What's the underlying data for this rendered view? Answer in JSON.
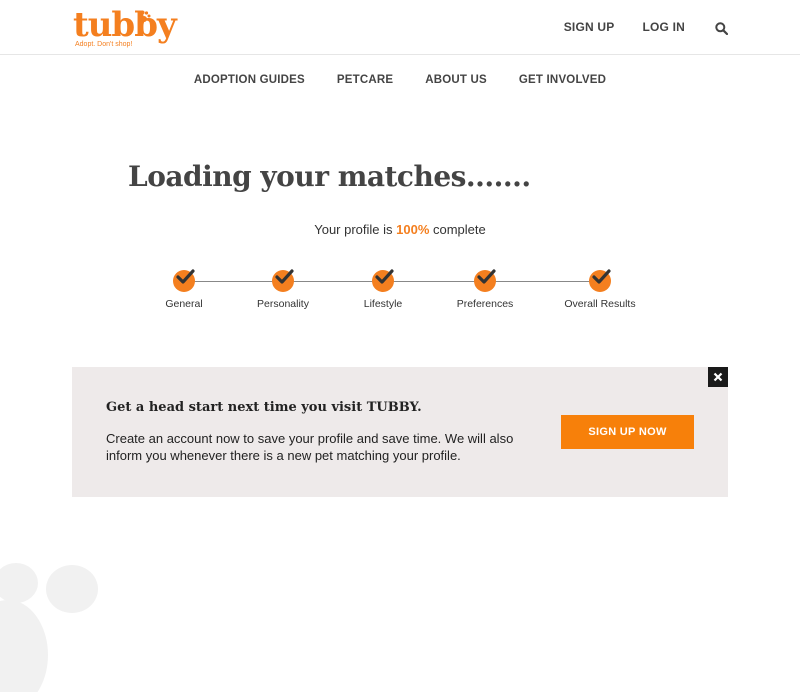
{
  "brand": {
    "name": "tubby",
    "tagline": "Adopt. Don't shop!",
    "accent_color": "#f47f1f"
  },
  "header": {
    "signup_label": "SIGN UP",
    "login_label": "LOG IN",
    "search_icon": "search-icon"
  },
  "nav": {
    "items": [
      "ADOPTION GUIDES",
      "PETCARE",
      "ABOUT US",
      "GET INVOLVED"
    ]
  },
  "main": {
    "heading": "Loading your matches.......",
    "progress_prefix": "Your profile is ",
    "progress_value": "100%",
    "progress_suffix": " complete",
    "steps": [
      {
        "label": "General",
        "completed": true
      },
      {
        "label": "Personality",
        "completed": true
      },
      {
        "label": "Lifestyle",
        "completed": true
      },
      {
        "label": "Preferences",
        "completed": true
      },
      {
        "label": "Overall Results",
        "completed": true
      }
    ]
  },
  "banner": {
    "title": "Get a head start next time you visit TUBBY.",
    "text": "Create an account now to save your profile and save time. We will also inform you whenever there is a new pet matching your profile.",
    "button_label": "SIGN UP NOW",
    "close_icon": "close-icon"
  }
}
